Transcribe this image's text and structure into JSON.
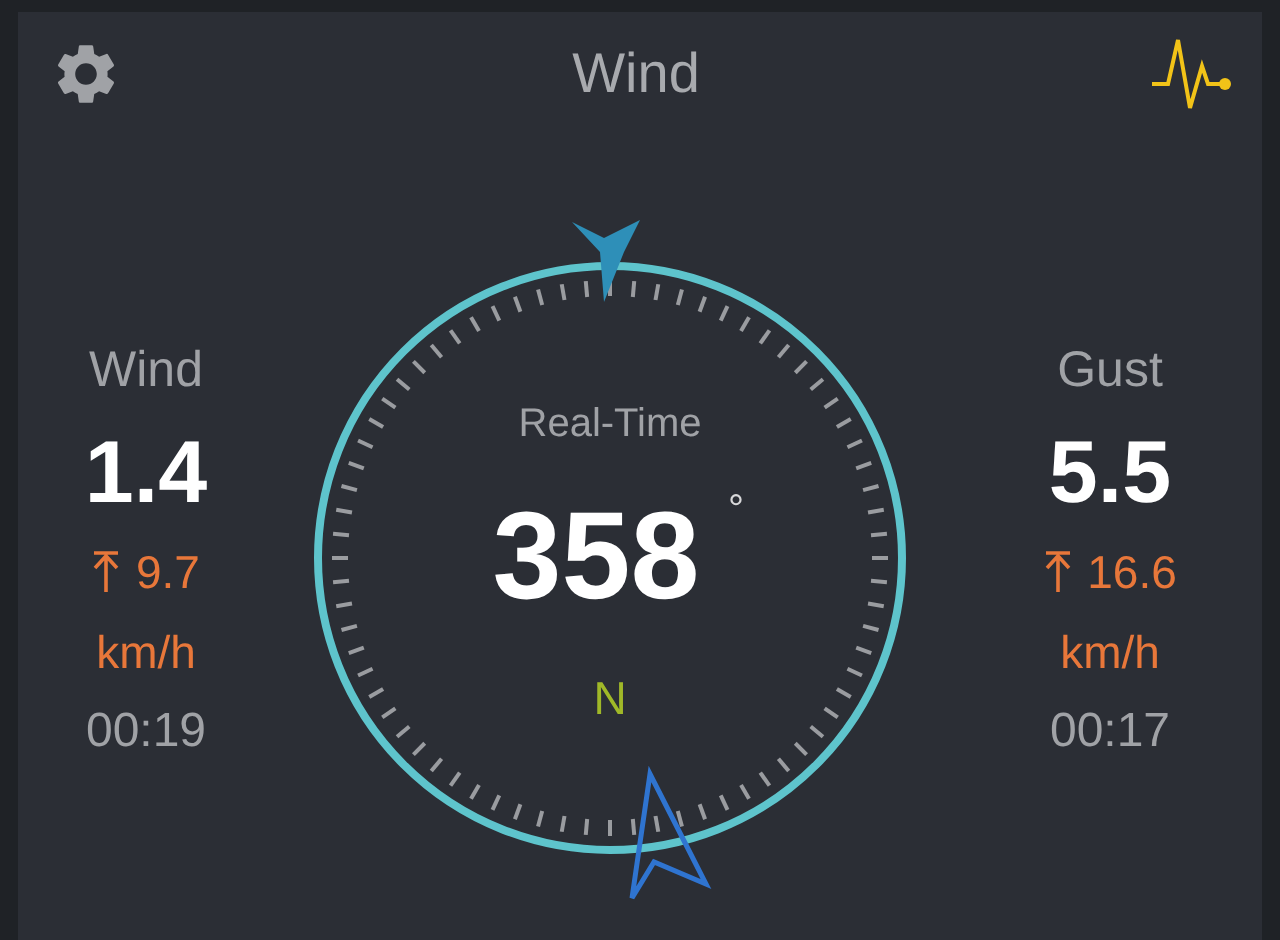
{
  "header": {
    "title": "Wind"
  },
  "compass": {
    "caption": "Real-Time",
    "direction": "358",
    "unit": "°",
    "cardinal": "N"
  },
  "stats": [
    {
      "label": "Wind",
      "value": "1.4",
      "max": "9.7",
      "unit": "km/h",
      "time": "00:19"
    },
    {
      "label": "Gust",
      "value": "5.5",
      "max": "16.6",
      "unit": "km/h",
      "time": "00:17"
    }
  ]
}
